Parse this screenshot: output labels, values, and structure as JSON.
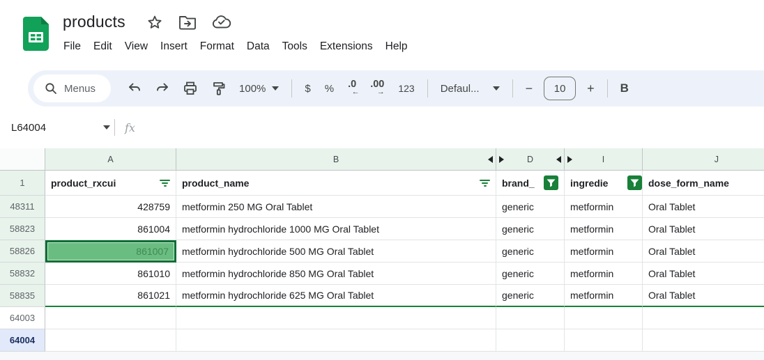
{
  "titlebar": {
    "doc_title": "products",
    "menu_items": [
      "File",
      "Edit",
      "View",
      "Insert",
      "Format",
      "Data",
      "Tools",
      "Extensions",
      "Help"
    ]
  },
  "toolbar": {
    "menus_label": "Menus",
    "zoom_value": "100%",
    "currency_label": "$",
    "percent_label": "%",
    "decrease_decimal_label": ".0",
    "decrease_decimal_arrow": "←",
    "increase_decimal_label": ".00",
    "increase_decimal_arrow": "→",
    "number_format_label": "123",
    "font_name_value": "Defaul...",
    "decrease_font_size_label": "−",
    "font_size_value": "10",
    "increase_font_size_label": "+",
    "bold_label": "B"
  },
  "formula_bar": {
    "name_box_value": "L64004",
    "fx_label": "fx"
  },
  "sheet": {
    "column_headers": [
      {
        "letter": "A"
      },
      {
        "letter": "B"
      },
      {
        "letter": "D"
      },
      {
        "letter": "I"
      },
      {
        "letter": "J"
      }
    ],
    "header_row": {
      "row_label": "1",
      "cells": [
        {
          "text": "product_rxcui",
          "filter": "inactive"
        },
        {
          "text": "product_name",
          "filter": "inactive"
        },
        {
          "text": "brand_",
          "filter": "active"
        },
        {
          "text": "ingredie",
          "filter": "active"
        },
        {
          "text": "dose_form_name",
          "filter": "none"
        }
      ]
    },
    "rows": [
      {
        "n": "48311",
        "a": "428759",
        "b": "metformin 250 MG Oral Tablet",
        "d": "generic",
        "i": "metformin",
        "j": "Oral Tablet"
      },
      {
        "n": "58823",
        "a": "861004",
        "b": "metformin hydrochloride 1000 MG Oral Tablet",
        "d": "generic",
        "i": "metformin",
        "j": "Oral Tablet"
      },
      {
        "n": "58826",
        "a": "861007",
        "b": "metformin hydrochloride 500 MG Oral Tablet",
        "d": "generic",
        "i": "metformin",
        "j": "Oral Tablet",
        "a_selected": true
      },
      {
        "n": "58832",
        "a": "861010",
        "b": "metformin hydrochloride 850 MG Oral Tablet",
        "d": "generic",
        "i": "metformin",
        "j": "Oral Tablet"
      },
      {
        "n": "58835",
        "a": "861021",
        "b": "metformin hydrochloride 625 MG Oral Tablet",
        "d": "generic",
        "i": "metformin",
        "j": "Oral Tablet"
      }
    ],
    "empty_rows": [
      {
        "n": "64003"
      },
      {
        "n": "64004",
        "active": true
      }
    ]
  },
  "colors": {
    "brand_green": "#12a159",
    "accent_green": "#188038",
    "selected_cell_fill": "#6abd80",
    "selected_cell_border": "#0b6e35",
    "selected_cell_text": "#3f8a55",
    "filtered_header_bg": "#e8f3ec",
    "active_row_header_bg": "#e1e9fb",
    "toolbar_bg": "#edf2fa"
  }
}
